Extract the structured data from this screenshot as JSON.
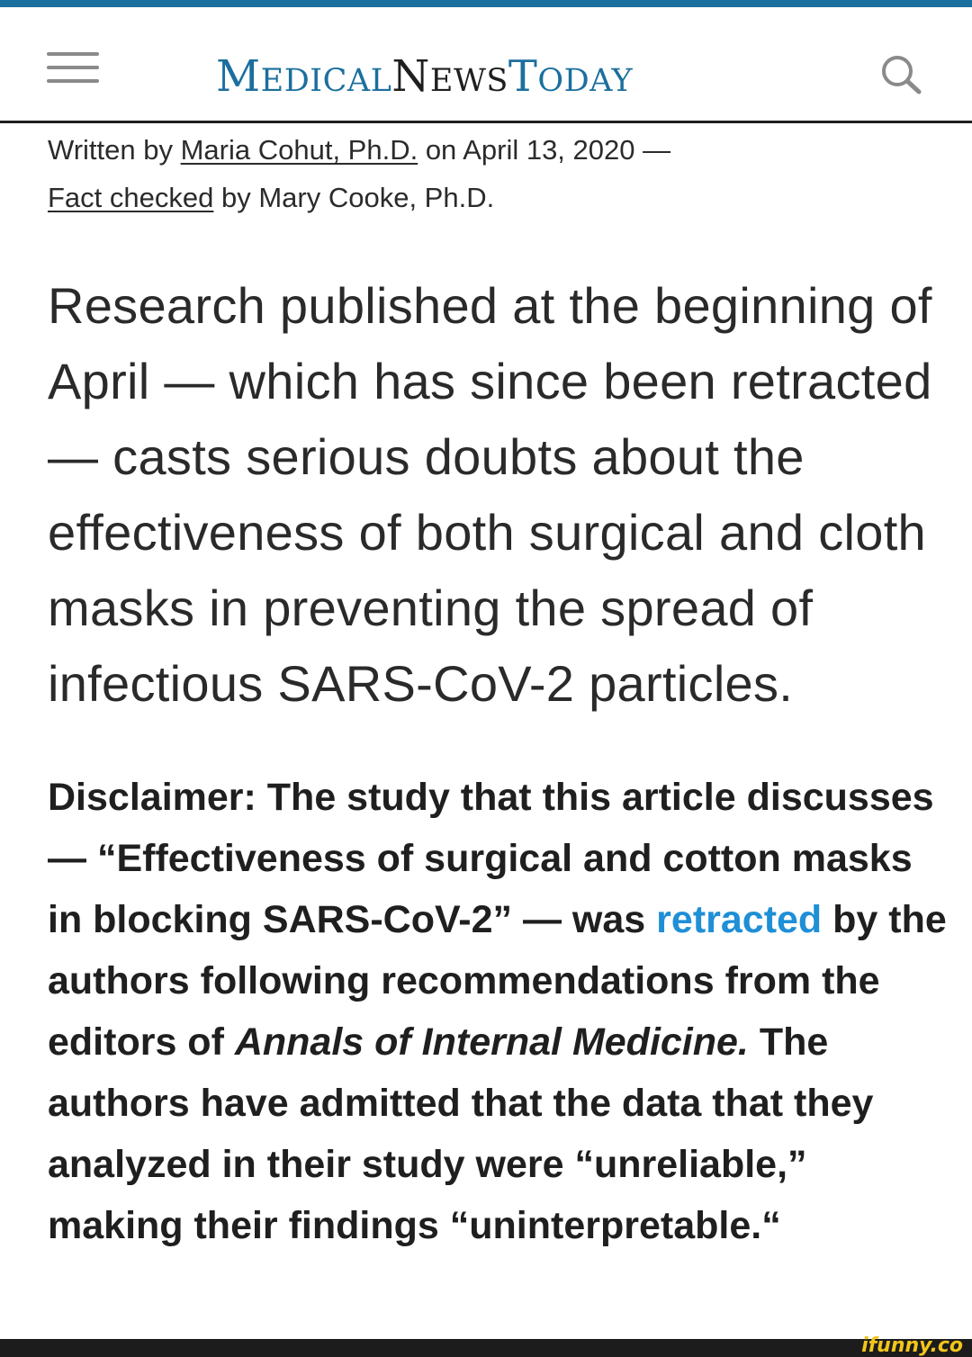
{
  "brand": {
    "accent_color": "#1b6f9e",
    "link_color": "#1f8fd6",
    "logo": {
      "part1_initial": "M",
      "part1_rest": "EDICAL",
      "part2_initial": "N",
      "part2_rest": "EWS",
      "part3_initial": "T",
      "part3_rest": "ODAY"
    }
  },
  "header": {
    "menu_icon": "hamburger-menu-icon",
    "search_icon": "search-icon"
  },
  "byline": {
    "written_by_prefix": "Written by ",
    "author": "Maria Cohut, Ph.D.",
    "date_text": " on April 13, 2020 —",
    "fact_checked_link": "Fact checked",
    "fact_checked_suffix": " by Mary Cooke, Ph.D."
  },
  "article": {
    "lead": "Research published at the beginning of April — which has since been retracted — casts serious doubts about the effectiveness of both surgical and cloth masks in preventing the spread of infectious SARS-CoV-2 particles.",
    "disclaimer": {
      "part1": "Disclaimer: The study that this article discusses — “Effectiveness of surgical and cotton masks in blocking SARS-CoV-2” — was ",
      "retracted_link": "retracted",
      "part2": " by the authors following recommendations from the editors of ",
      "journal": "Annals of Internal Medicine.",
      "part3": " The authors have admitted that the data that they analyzed in their study were “unreliable,” making their findings “uninterpretable.“"
    }
  },
  "watermark": {
    "text": "ifunny.co"
  }
}
